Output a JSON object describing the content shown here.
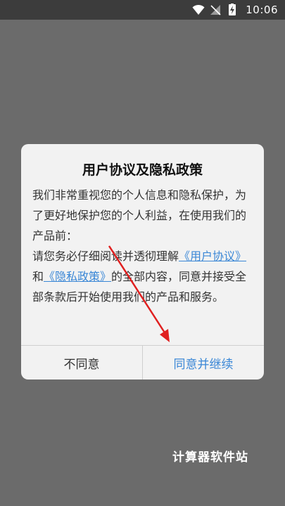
{
  "status_bar": {
    "time": "10:06",
    "icons": [
      "wifi-icon",
      "no-signal-icon",
      "battery-charging-icon"
    ]
  },
  "dialog": {
    "title": "用户协议及隐私政策",
    "paragraph1": "我们非常重视您的个人信息和隐私保护，为了更好地保护您的个人利益，在使用我们的产品前：",
    "p2_prefix": "请您务必仔细阅读并透彻理解",
    "user_agreement_link": "《用户协议》",
    "p2_and": "和",
    "privacy_policy_link": "《隐私政策》",
    "p2_suffix": "的全部内容，同意并接受全部条款后开始使用我们的产品和服务。",
    "disagree_button": "不同意",
    "agree_button": "同意并继续"
  },
  "watermark": "计算器软件站",
  "colors": {
    "accent": "#3a87d6",
    "overlay": "#6b6b6b",
    "dialog_bg": "#f2f2f2",
    "arrow": "#e02020"
  }
}
